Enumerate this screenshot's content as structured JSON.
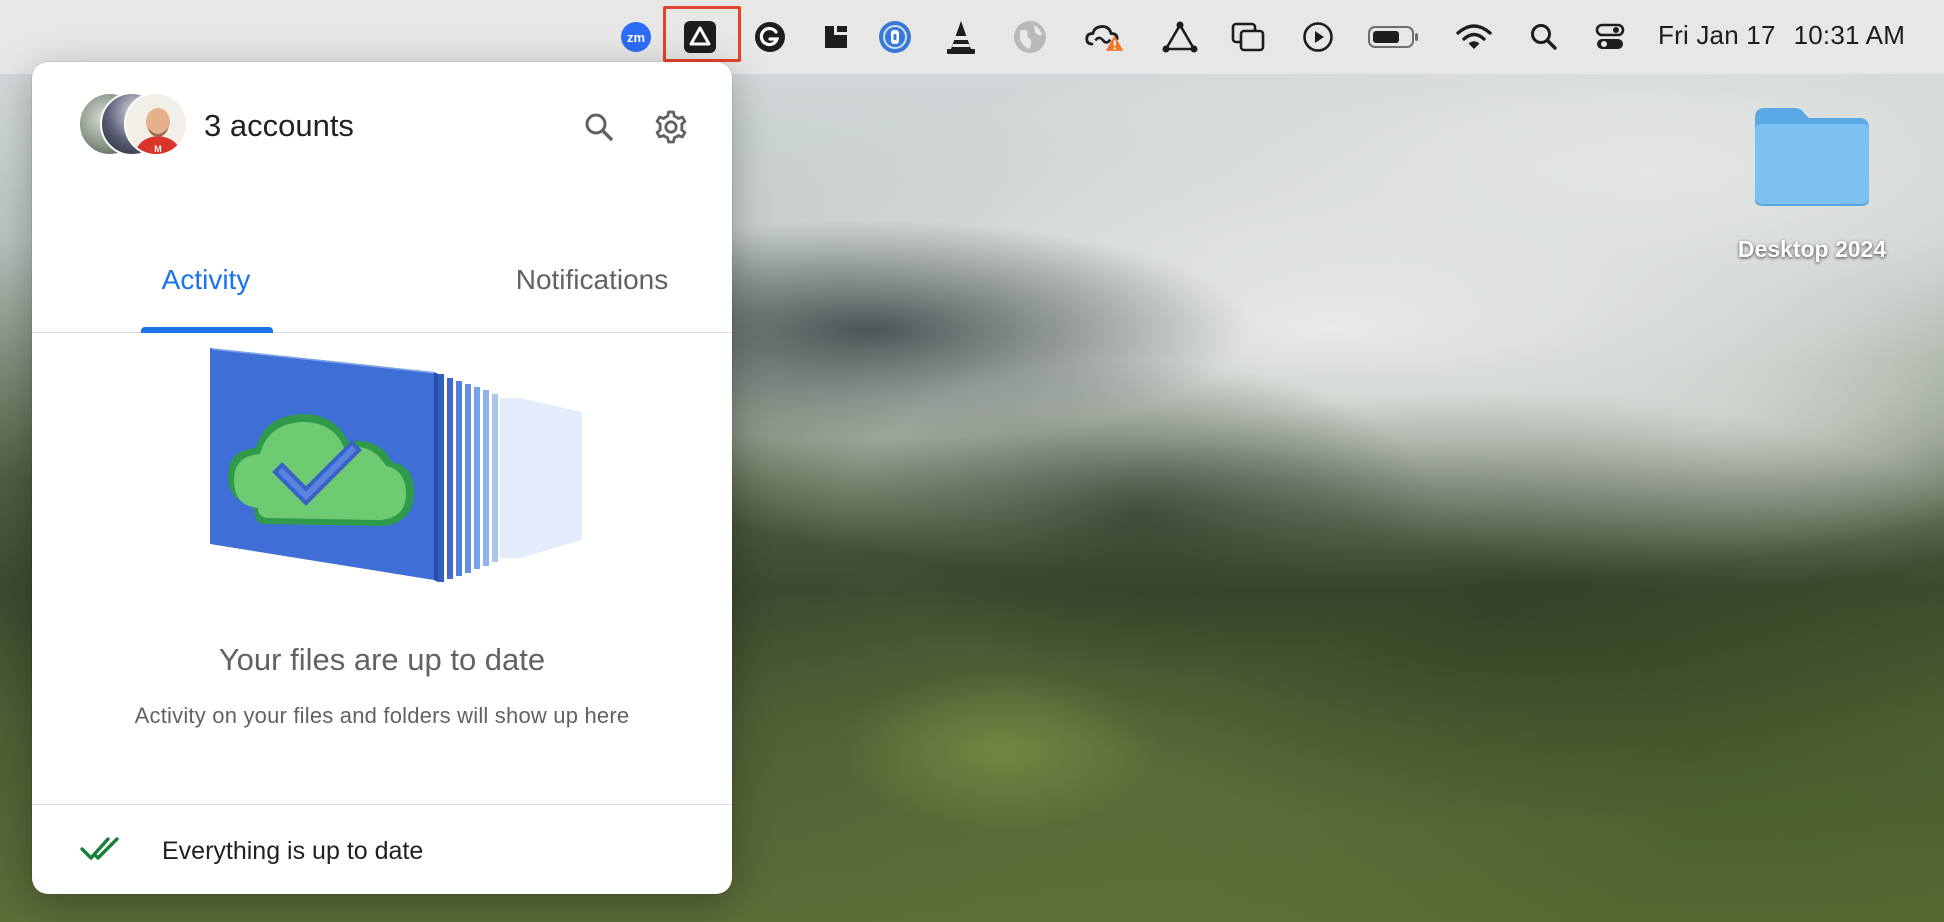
{
  "menubar": {
    "icons": [
      "zoom-icon",
      "google-drive-icon",
      "grammarly-icon",
      "notch-app-icon",
      "password-manager-icon",
      "vlc-icon",
      "globe-icon",
      "creative-cloud-icon",
      "triangle-app-icon",
      "window-manager-icon",
      "play-icon",
      "battery-icon",
      "wifi-icon",
      "spotlight-search-icon",
      "control-center-icon"
    ],
    "zoom_label": "zm",
    "highlighted_icon": "google-drive-icon",
    "highlight_color": "#e3432c",
    "date": "Fri Jan 17",
    "time": "10:31 AM"
  },
  "desktop": {
    "folder_label": "Desktop 2024",
    "folder_color": "#7cc1f2"
  },
  "panel": {
    "accounts_label": "3 accounts",
    "tabs": [
      {
        "label": "Activity",
        "active": true
      },
      {
        "label": "Notifications",
        "active": false
      }
    ],
    "accent_color": "#1a73e8",
    "empty_title": "Your files are up to date",
    "empty_subtitle": "Activity on your files and folders will show up here",
    "footer_status": "Everything is up to date",
    "status_color": "#188038"
  }
}
